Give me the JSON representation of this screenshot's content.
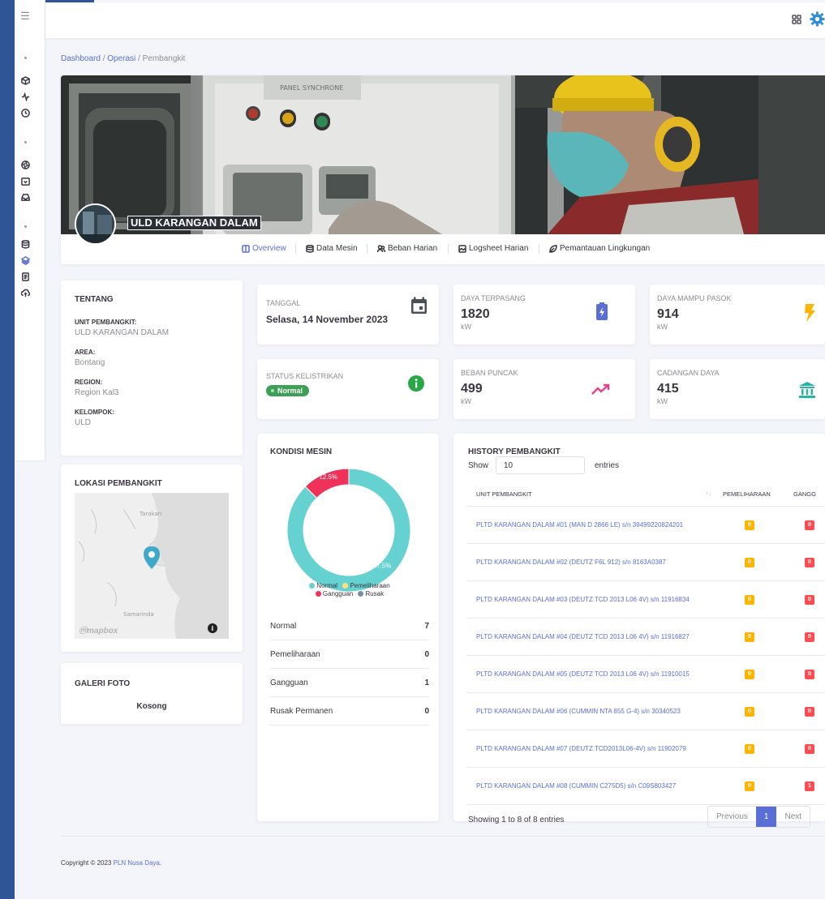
{
  "breadcrumb": {
    "home": "Dashboard",
    "section": "Operasi",
    "current": "Pembangkit"
  },
  "hero": {
    "unit_name": "ULD KARANGAN DALAM",
    "photo_label": "PANEL SYNCHRONE",
    "tabs": [
      {
        "label": "Overview",
        "icon": "columns-icon",
        "active": true
      },
      {
        "label": "Data Mesin",
        "icon": "database-icon",
        "active": false
      },
      {
        "label": "Beban Harian",
        "icon": "users-icon",
        "active": false
      },
      {
        "label": "Logsheet Harian",
        "icon": "image-icon",
        "active": false
      },
      {
        "label": "Pemantauan Lingkungan",
        "icon": "leaf-icon",
        "active": false
      }
    ]
  },
  "tentang": {
    "title": "TENTANG",
    "fields": [
      {
        "label": "UNIT PEMBANGKIT:",
        "value": "ULD KARANGAN DALAM"
      },
      {
        "label": "AREA:",
        "value": "Bontang"
      },
      {
        "label": "REGION:",
        "value": "Region Kal3"
      },
      {
        "label": "KELOMPOK:",
        "value": "ULD"
      }
    ]
  },
  "lokasi": {
    "title": "LOKASI PEMBANGKIT",
    "labels": [
      "Tarakan",
      "Samarinda"
    ],
    "attribution": "mapbox"
  },
  "galeri": {
    "title": "GALERI FOTO",
    "empty": "Kosong"
  },
  "tanggal": {
    "label": "TANGGAL",
    "value": "Selasa, 14 November 2023",
    "icon": "calendar-icon"
  },
  "status": {
    "label": "STATUS KELISTRIKAN",
    "badge": "Normal",
    "icon": "info-icon"
  },
  "stats": [
    {
      "label": "DAYA TERPASANG",
      "value": "1820",
      "unit": "kW",
      "icon": "battery-icon",
      "color": "#5a6fd6"
    },
    {
      "label": "DAYA MAMPU PASOK",
      "value": "914",
      "unit": "kW",
      "icon": "bolt-icon",
      "color": "#ffb400"
    },
    {
      "label": "BEBAN PUNCAK",
      "value": "499",
      "unit": "kW",
      "icon": "trending-up-icon",
      "color": "#e83e8c"
    },
    {
      "label": "CADANGAN DAYA",
      "value": "415",
      "unit": "kW",
      "icon": "bank-icon",
      "color": "#26b5a8"
    }
  ],
  "kondisi": {
    "title": "KONDISI MESIN",
    "legend": [
      {
        "name": "Normal",
        "color": "#66d1d1"
      },
      {
        "name": "Pemeliharaan",
        "color": "#ffe27a"
      },
      {
        "name": "Gangguan",
        "color": "#f0325a"
      },
      {
        "name": "Rusak",
        "color": "#7b8ba6"
      }
    ],
    "rows": [
      {
        "name": "Normal",
        "count": "7"
      },
      {
        "name": "Pemeliharaan",
        "count": "0"
      },
      {
        "name": "Gangguan",
        "count": "1"
      },
      {
        "name": "Rusak Permanen",
        "count": "0"
      }
    ]
  },
  "chart_data": {
    "type": "pie",
    "categories": [
      "Normal",
      "Pemeliharaan",
      "Gangguan",
      "Rusak"
    ],
    "values": [
      7,
      0,
      1,
      0
    ],
    "data_labels": [
      "87.5%",
      "",
      "12.5%",
      ""
    ],
    "colors": [
      "#66d1d1",
      "#ffe27a",
      "#f0325a",
      "#7b8ba6"
    ],
    "legend_position": "bottom"
  },
  "history": {
    "title": "HISTORY PEMBANGKIT",
    "show_label": "Show",
    "page_size": "10",
    "entries_label": "entries",
    "columns": [
      "UNIT PEMBANGKIT",
      "PEMELIHARAAN",
      "GANGG"
    ],
    "sort_icon": "↑↓",
    "rows": [
      {
        "unit": "PLTD KARANGAN DALAM #01 (MAN D 2866 LE) s/n 39499220824201",
        "pemeliharaan": "0",
        "gangguan": "0"
      },
      {
        "unit": "PLTD KARANGAN DALAM #02 (DEUTZ F6L 912) s/n 8163A0387",
        "pemeliharaan": "0",
        "gangguan": "0"
      },
      {
        "unit": "PLTD KARANGAN DALAM #03 (DEUTZ TCD 2013 L06 4V) s/n 11916834",
        "pemeliharaan": "0",
        "gangguan": "0"
      },
      {
        "unit": "PLTD KARANGAN DALAM #04 (DEUTZ TCD 2013 L06 4V) s/n 11916827",
        "pemeliharaan": "0",
        "gangguan": "0"
      },
      {
        "unit": "PLTD KARANGAN DALAM #05 (DEUTZ TCD 2013 L06 4V) s/n 11910015",
        "pemeliharaan": "0",
        "gangguan": "0"
      },
      {
        "unit": "PLTD KARANGAN DALAM #06 (CUMMIN NTA 855 G-4) s/n 30340523",
        "pemeliharaan": "0",
        "gangguan": "0"
      },
      {
        "unit": "PLTD KARANGAN DALAM #07 (DEUTZ TCD2013L06-4V) s/n 11902079",
        "pemeliharaan": "0",
        "gangguan": "0"
      },
      {
        "unit": "PLTD KARANGAN DALAM #08 (CUMMIN C275D5) s/n C09S803427",
        "pemeliharaan": "0",
        "gangguan": "1"
      }
    ],
    "info": "Showing 1 to 8 of 8 entries",
    "prev": "Previous",
    "page": "1",
    "next": "Next"
  },
  "footer": {
    "text": "Copyright © 2023 ",
    "link": "PLN Nusa Daya."
  }
}
